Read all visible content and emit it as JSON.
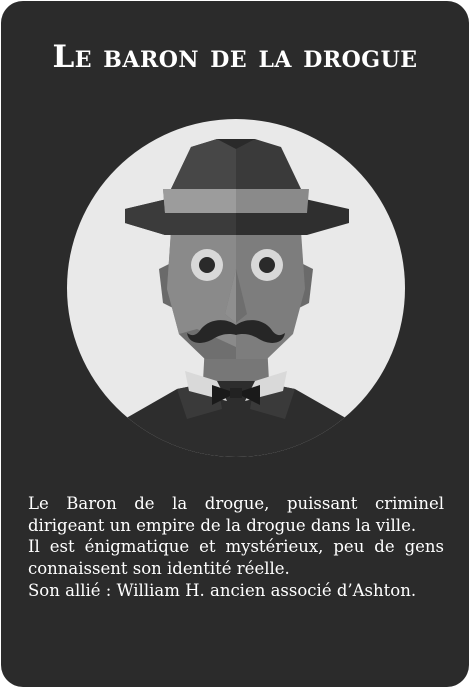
{
  "card": {
    "title": "Le baron de la drogue",
    "portrait_icon": "mustached-man-in-fedora-portrait",
    "description": [
      "Le Baron de la drogue, puissant criminel dirigeant un empire de la drogue dans la ville.",
      "Il est énigmatique et mystérieux, peu de gens connaissent son identité réelle.",
      "Son allié : William H. ancien associé d’Ashton."
    ]
  },
  "colors": {
    "card_background": "#2b2b2b",
    "text": "#ffffff",
    "portrait_circle": "#e9e9e9"
  }
}
